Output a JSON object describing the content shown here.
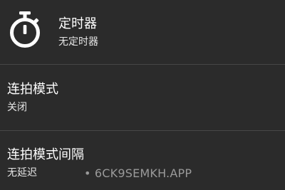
{
  "settings": {
    "timer": {
      "icon": "stopwatch-icon",
      "title": "定时器",
      "value": "无定时器"
    },
    "burst_mode": {
      "title": "连拍模式",
      "value": "关闭"
    },
    "burst_interval": {
      "title": "连拍模式间隔",
      "value": "无延迟"
    }
  },
  "watermark": {
    "text": "• 6CK9SEMKH.APP"
  },
  "colors": {
    "background": "#2b2b2b",
    "divider": "#474747",
    "text_primary": "#ffffff",
    "text_secondary": "#e6e6e6",
    "watermark": "#9a9a9a"
  }
}
